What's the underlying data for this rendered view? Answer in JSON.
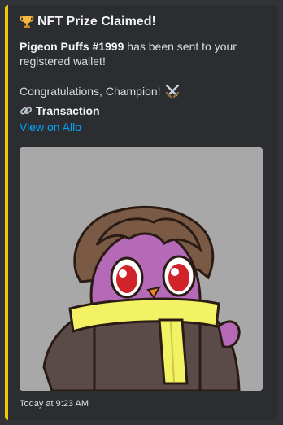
{
  "embed": {
    "accent_color": "#f0c808",
    "title_icon": "trophy-icon",
    "title": "NFT Prize Claimed!",
    "description": {
      "nft_name": "Pigeon Puffs #1999",
      "line1_rest": " has been sent to your",
      "line2": "registered wallet!"
    },
    "congrats": "Congratulations, Champion!",
    "congrats_icon": "crossed-swords-icon",
    "field": {
      "icon": "link-icon",
      "name": "Transaction",
      "value": "View on Allo"
    },
    "image_icon": "pigeon-nft-avatar",
    "footer": "Today at 9:23 AM"
  }
}
